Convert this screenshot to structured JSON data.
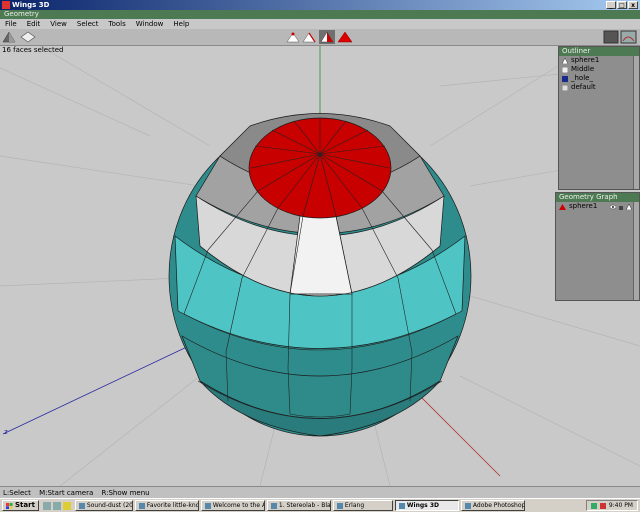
{
  "window": {
    "title": "Wings 3D",
    "geometry_bar": "Geometry"
  },
  "menu": [
    "File",
    "Edit",
    "View",
    "Select",
    "Tools",
    "Window",
    "Help"
  ],
  "toolbar": {
    "left_icons": [
      "cube-view-icon",
      "wire-view-icon"
    ],
    "select_modes": [
      "vertex-mode-icon",
      "edge-mode-icon",
      "face-mode-icon",
      "body-mode-icon"
    ],
    "right_icons": [
      "render-icon",
      "camera-icon"
    ]
  },
  "viewport": {
    "info": "16 faces selected"
  },
  "outliner": {
    "title": "Outliner",
    "items": [
      {
        "label": "sphere1",
        "icon": "object-icon"
      },
      {
        "label": "Middle",
        "icon": "image-icon"
      },
      {
        "label": "_hole_",
        "icon": "material-icon"
      },
      {
        "label": "default",
        "icon": "material-icon"
      }
    ]
  },
  "geometry_graph": {
    "title": "Geometry Graph",
    "items": [
      {
        "label": "sphere1",
        "icon": "object-icon"
      }
    ]
  },
  "statusbar": {
    "hints": [
      "L:Select",
      "M:Start camera",
      "R:Show menu"
    ]
  },
  "taskbar": {
    "start": "Start",
    "tasks": [
      {
        "label": "Sound-dust (2001)",
        "active": false
      },
      {
        "label": "Favorite little-know...",
        "active": false
      },
      {
        "label": "Welcome to the Art ...",
        "active": false
      },
      {
        "label": "1. Stereolab - Black ...",
        "active": false
      },
      {
        "label": "Erlang",
        "active": false
      },
      {
        "label": "Wings 3D",
        "active": true
      },
      {
        "label": "Adobe Photoshop",
        "active": false
      }
    ],
    "clock": "9:40 PM"
  },
  "colors": {
    "selected": "#c80000",
    "teal": "#3aa6a6",
    "white": "#ececec",
    "grey": "#a8a8a8",
    "panel_title": "#4d7a52"
  }
}
